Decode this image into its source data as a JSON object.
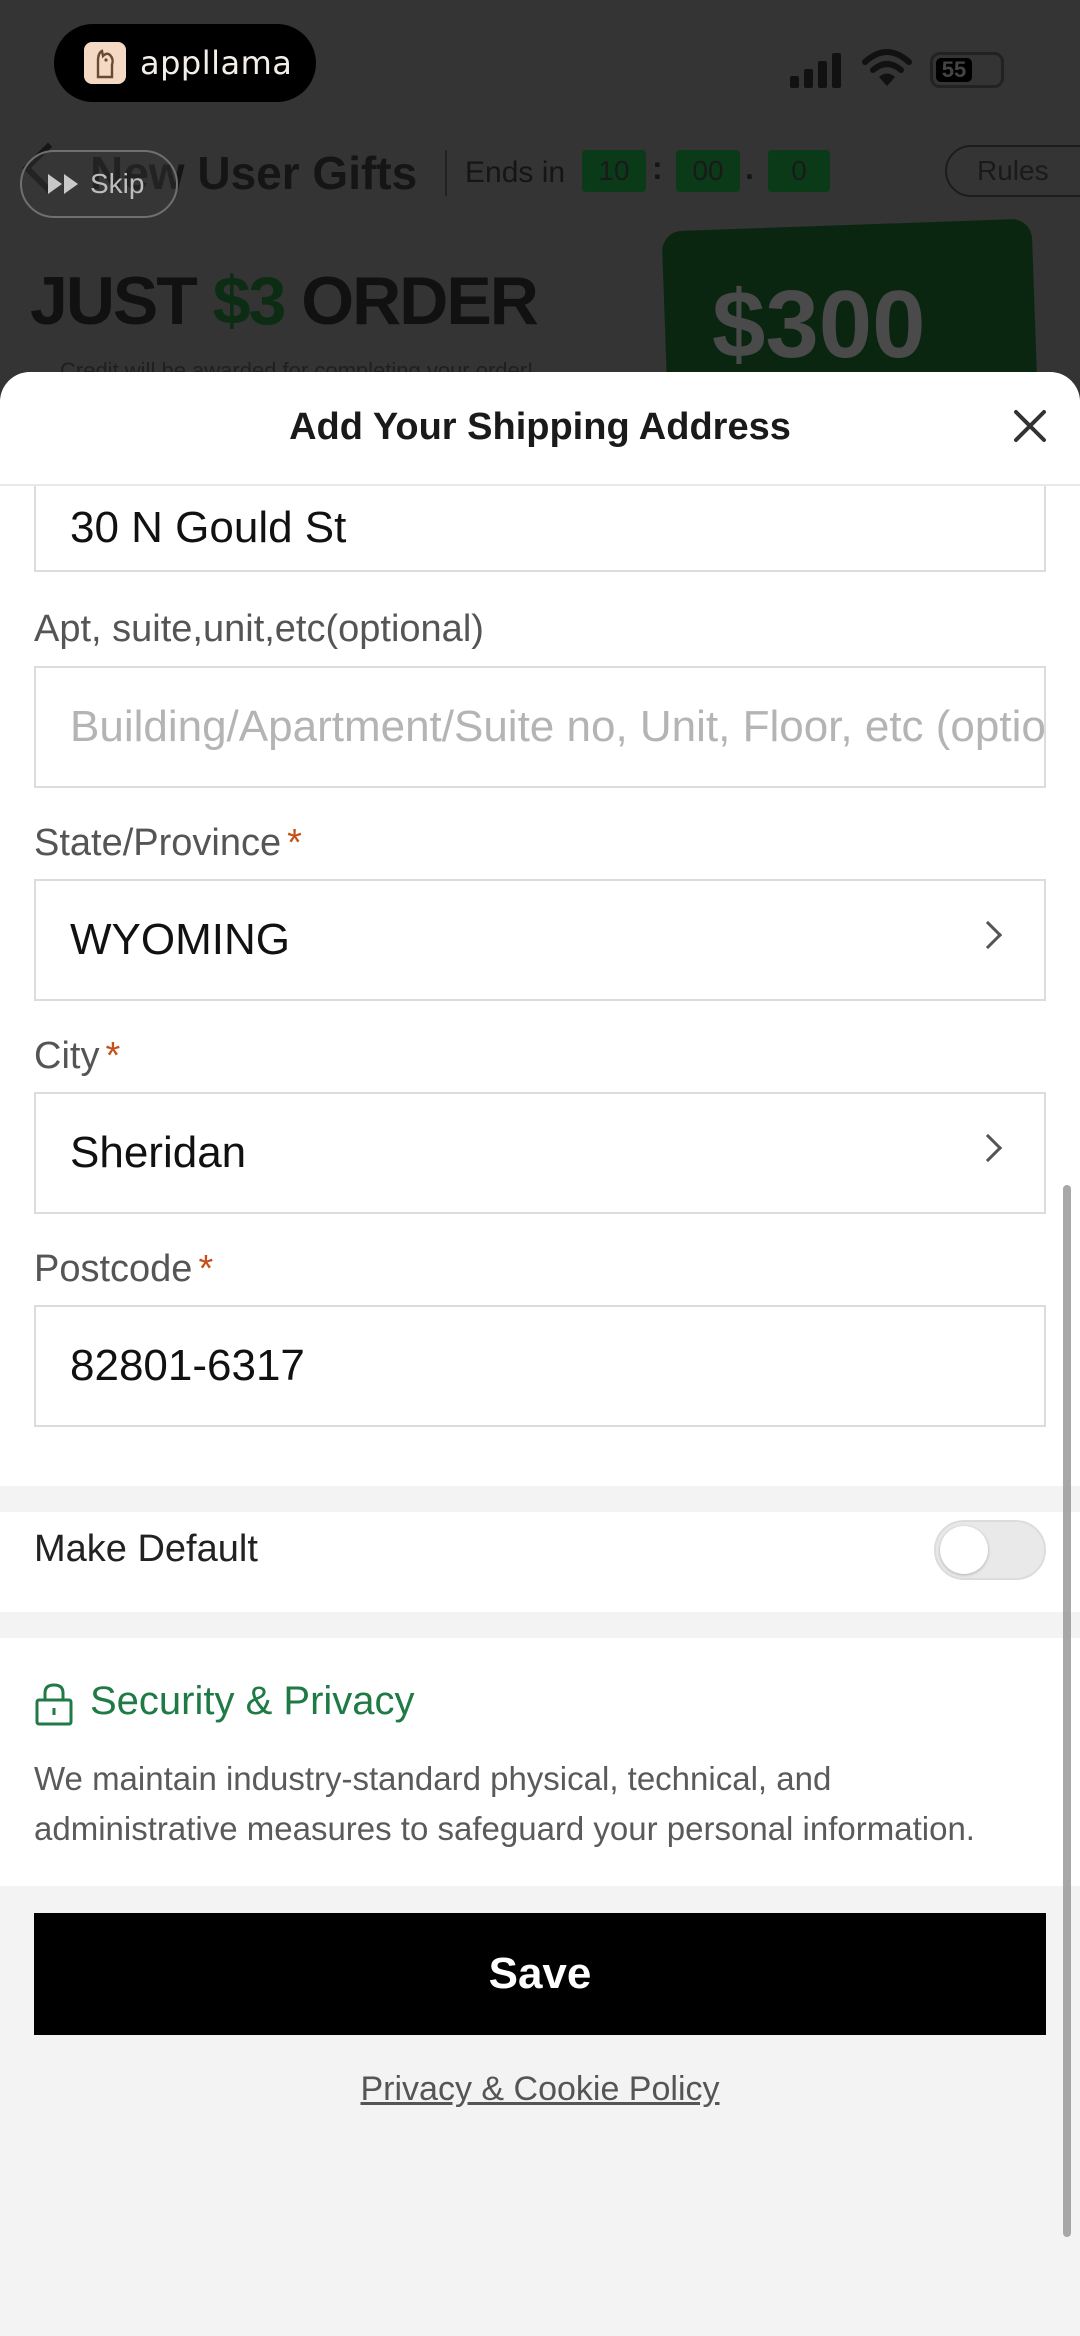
{
  "status_bar": {
    "brand_name": "appllama",
    "battery_level": "55"
  },
  "background": {
    "title": "New User Gifts",
    "ends_in_label": "Ends in",
    "timer_hours": "10",
    "timer_minutes": "00",
    "timer_tenths": "0",
    "rules_label": "Rules",
    "headline_part1": "JUST ",
    "headline_price": "$3",
    "headline_part2": " ORDER",
    "subline": "Credit will be awarded for completing your order!",
    "card_amount": "$300",
    "skip_label": "Skip"
  },
  "sheet": {
    "title": "Add Your Shipping Address",
    "street_value": "30 N Gould St",
    "apt_label": "Apt, suite,unit,etc(optional)",
    "apt_placeholder": "Building/Apartment/Suite no, Unit, Floor, etc (optional)",
    "state_label": "State/Province",
    "state_value": "WYOMING",
    "city_label": "City",
    "city_value": "Sheridan",
    "postcode_label": "Postcode",
    "postcode_value": "82801-6317",
    "required_mark": "*",
    "make_default_label": "Make Default",
    "make_default_on": false,
    "security_title": "Security & Privacy",
    "security_body": "We maintain industry-standard physical, technical, and administrative measures to safeguard your personal information.",
    "save_label": "Save",
    "policy_link": "Privacy & Cookie Policy"
  },
  "colors": {
    "accent_green": "#1f7a46",
    "required_orange": "#c4511a",
    "primary_button": "#000000"
  }
}
